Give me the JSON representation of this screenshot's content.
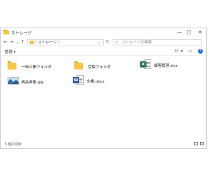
{
  "window": {
    "title": "ストレージ",
    "controls": {
      "minimize": "—",
      "maximize": "□",
      "close": "✕"
    }
  },
  "nav": {
    "back": "←",
    "forward": "→",
    "history": "⌄",
    "up": "↑"
  },
  "address": {
    "path": "ストレージ",
    "chevron": "›",
    "dropdown": "⌄"
  },
  "search": {
    "placeholder": "ストレージの検索"
  },
  "toolbar": {
    "organize": "整理 ▾",
    "view_more": "▾"
  },
  "items": [
    {
      "name": "一時公開フォルダ",
      "type": "folder"
    },
    {
      "name": "受取フォルダ",
      "type": "folder"
    },
    {
      "name": "顧客管理.xlsx",
      "type": "excel"
    },
    {
      "name": "商品画像.jpg",
      "type": "image"
    },
    {
      "name": "文書.docx",
      "type": "word"
    }
  ],
  "status": {
    "count_text": "5 個の項目"
  },
  "colors": {
    "folder": "#f6c74b",
    "excel": "#1e7145",
    "word": "#2b5797",
    "help": "#2b6cd1"
  }
}
